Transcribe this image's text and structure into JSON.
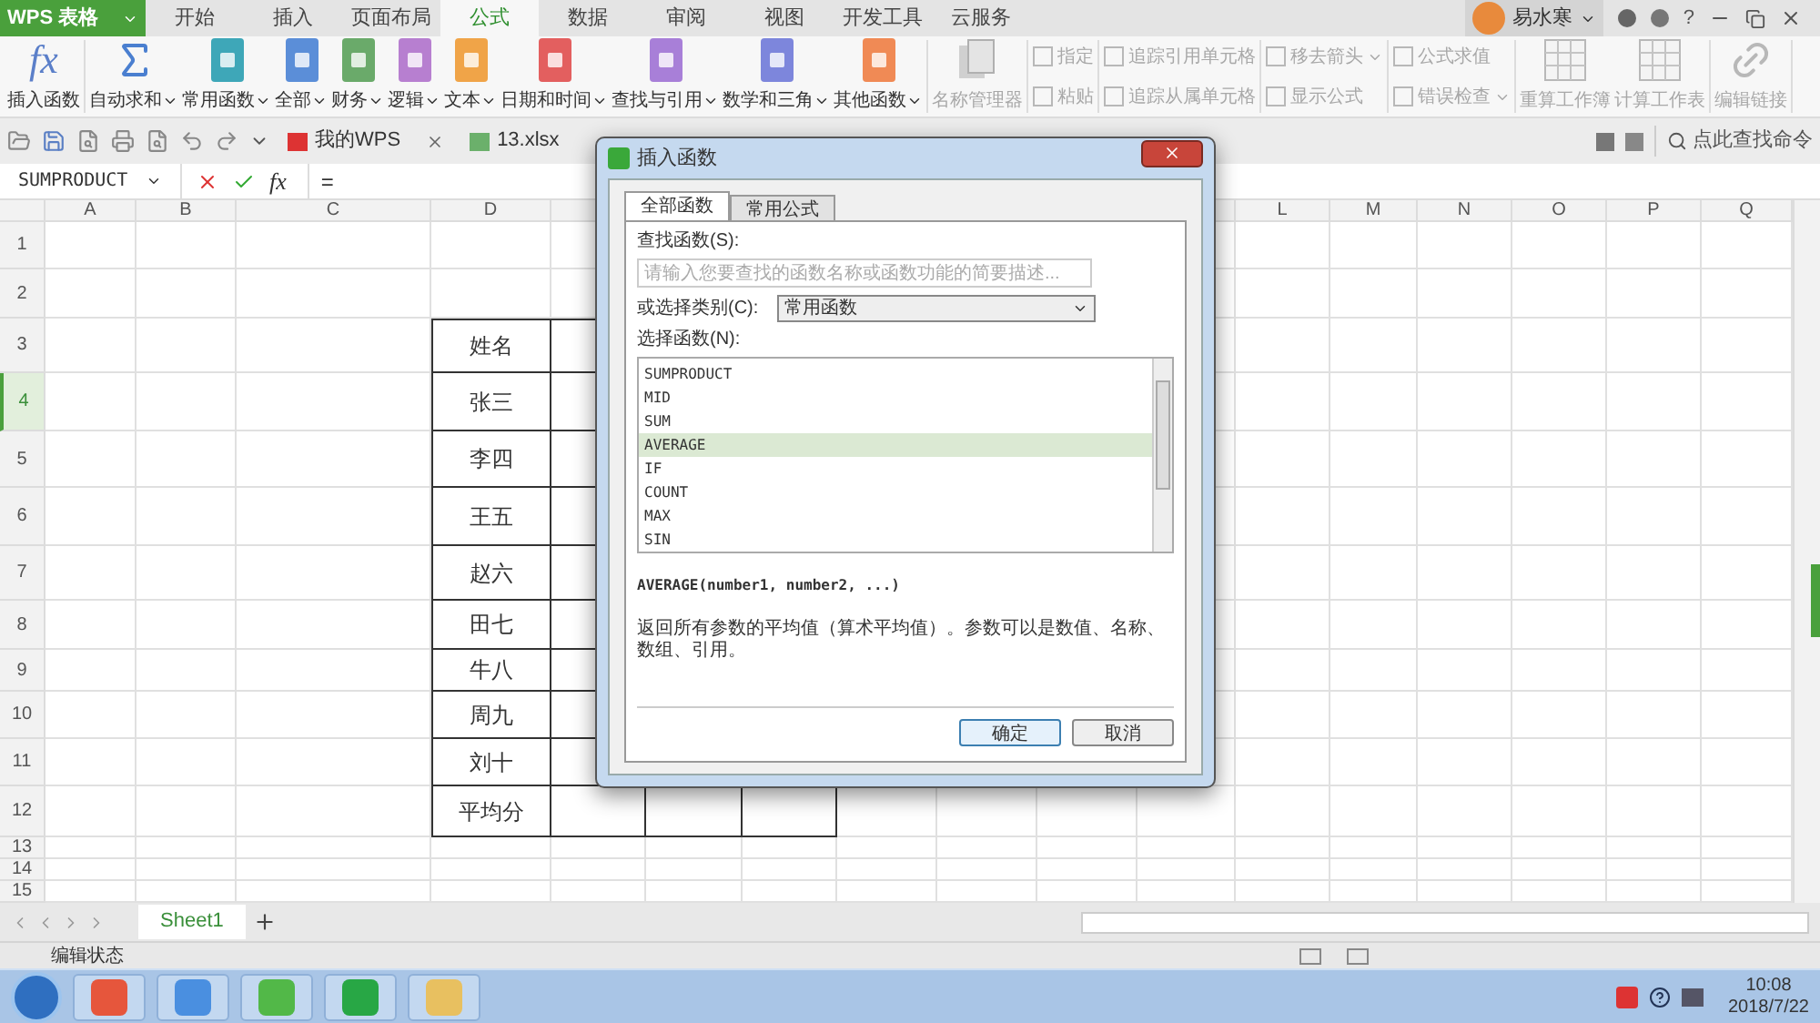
{
  "app": {
    "title": "WPS 表格"
  },
  "menu_tabs": [
    {
      "label": "开始",
      "selected": false
    },
    {
      "label": "插入",
      "selected": false
    },
    {
      "label": "页面布局",
      "selected": false
    },
    {
      "label": "公式",
      "selected": true
    },
    {
      "label": "数据",
      "selected": false
    },
    {
      "label": "审阅",
      "selected": false
    },
    {
      "label": "视图",
      "selected": false
    },
    {
      "label": "开发工具",
      "selected": false
    },
    {
      "label": "云服务",
      "selected": false
    }
  ],
  "user": {
    "name": "易水寒",
    "help": "?"
  },
  "ribbon": {
    "sections": [
      {
        "kind": "large",
        "items": [
          {
            "kind": "fx",
            "glyph": "fx",
            "label": "插入函数",
            "dropdown": false,
            "disabled": false
          }
        ]
      },
      {
        "kind": "large",
        "items": [
          {
            "kind": "sum",
            "label": "自动求和",
            "dropdown": true,
            "disabled": false
          },
          {
            "kind": "book",
            "label": "常用函数",
            "dropdown": true,
            "disabled": false,
            "color": "#3ea7b8"
          },
          {
            "kind": "book",
            "label": "全部",
            "dropdown": true,
            "disabled": false,
            "color": "#5b8ed8"
          },
          {
            "kind": "book",
            "label": "财务",
            "dropdown": true,
            "disabled": false,
            "color": "#6aaa6a"
          },
          {
            "kind": "book",
            "label": "逻辑",
            "dropdown": true,
            "disabled": false,
            "color": "#b77fd0"
          },
          {
            "kind": "book",
            "label": "文本",
            "dropdown": true,
            "disabled": false,
            "color": "#f0a448"
          },
          {
            "kind": "book",
            "label": "日期和时间",
            "dropdown": true,
            "disabled": false,
            "color": "#e35f5f"
          },
          {
            "kind": "book",
            "label": "查找与引用",
            "dropdown": true,
            "disabled": false,
            "color": "#a87fd8"
          },
          {
            "kind": "book",
            "label": "数学和三角",
            "dropdown": true,
            "disabled": false,
            "color": "#7d86dc"
          },
          {
            "kind": "book",
            "label": "其他函数",
            "dropdown": true,
            "disabled": false,
            "color": "#f08a55"
          }
        ]
      },
      {
        "kind": "large",
        "items": [
          {
            "kind": "doc",
            "label": "名称管理器",
            "dropdown": false,
            "disabled": true
          }
        ]
      },
      {
        "kind": "stack",
        "items": [
          {
            "kind": "small",
            "label": "指定",
            "dropdown": false,
            "disabled": true
          },
          {
            "kind": "small",
            "label": "粘贴",
            "dropdown": false,
            "disabled": true
          }
        ]
      },
      {
        "kind": "stack",
        "items": [
          {
            "kind": "small",
            "label": "追踪引用单元格",
            "dropdown": false,
            "disabled": true
          },
          {
            "kind": "small",
            "label": "追踪从属单元格",
            "dropdown": false,
            "disabled": true
          }
        ]
      },
      {
        "kind": "stack",
        "items": [
          {
            "kind": "small",
            "label": "移去箭头",
            "dropdown": true,
            "disabled": true
          },
          {
            "kind": "small",
            "label": "显示公式",
            "dropdown": false,
            "disabled": true
          }
        ]
      },
      {
        "kind": "stack",
        "items": [
          {
            "kind": "small",
            "label": "公式求值",
            "dropdown": false,
            "disabled": true
          },
          {
            "kind": "small",
            "label": "错误检查",
            "dropdown": true,
            "disabled": true
          }
        ]
      },
      {
        "kind": "large",
        "items": [
          {
            "kind": "table",
            "label": "重算工作簿",
            "dropdown": false,
            "disabled": true
          },
          {
            "kind": "table",
            "label": "计算工作表",
            "dropdown": false,
            "disabled": true
          }
        ]
      },
      {
        "kind": "large",
        "items": [
          {
            "kind": "link",
            "label": "编辑链接",
            "dropdown": false,
            "disabled": true
          }
        ]
      }
    ]
  },
  "doc_tabs": [
    {
      "label": "我的WPS",
      "closable": true
    },
    {
      "label": "13.xlsx",
      "closable": false
    }
  ],
  "command_search": {
    "placeholder": "点此查找命令"
  },
  "formula_bar": {
    "name_box": "SUMPRODUCT",
    "fx": "fx",
    "value": "="
  },
  "sheet": {
    "columns_left": [
      "A",
      "B",
      "C",
      "D"
    ],
    "columns_right": [
      "L",
      "M",
      "N",
      "O",
      "P",
      "Q"
    ],
    "rows": [
      {
        "number": "1",
        "selected": false
      },
      {
        "number": "2",
        "selected": false
      },
      {
        "number": "3",
        "selected": false,
        "column_D": "姓名"
      },
      {
        "number": "4",
        "selected": true,
        "column_D": "张三"
      },
      {
        "number": "5",
        "selected": false,
        "column_D": "李四"
      },
      {
        "number": "6",
        "selected": false,
        "column_D": "王五"
      },
      {
        "number": "7",
        "selected": false,
        "column_D": "赵六"
      },
      {
        "number": "8",
        "selected": false,
        "column_D": "田七"
      },
      {
        "number": "9",
        "selected": false,
        "column_D": "牛八"
      },
      {
        "number": "10",
        "selected": false,
        "column_D": "周九"
      },
      {
        "number": "11",
        "selected": false,
        "column_D": "刘十"
      },
      {
        "number": "12",
        "selected": false,
        "column_D": "平均分"
      },
      {
        "number": "13",
        "selected": false
      },
      {
        "number": "14",
        "selected": false
      },
      {
        "number": "15",
        "selected": false
      }
    ]
  },
  "sheet_tabs": [
    {
      "label": "Sheet1",
      "selected": true
    }
  ],
  "status_bar": {
    "text": "编辑状态"
  },
  "dialog": {
    "title": "插入函数",
    "tabs": [
      {
        "label": "全部函数",
        "selected": true
      },
      {
        "label": "常用公式",
        "selected": false
      }
    ],
    "search_label": "查找函数(S):",
    "search_placeholder": "请输入您要查找的函数名称或函数功能的简要描述...",
    "category_label": "或选择类别(C):",
    "category_value": "常用函数",
    "list_label": "选择函数(N):",
    "functions": [
      {
        "name": "SUMPRODUCT",
        "selected": false
      },
      {
        "name": "MID",
        "selected": false
      },
      {
        "name": "SUM",
        "selected": false
      },
      {
        "name": "AVERAGE",
        "selected": true
      },
      {
        "name": "IF",
        "selected": false
      },
      {
        "name": "COUNT",
        "selected": false
      },
      {
        "name": "MAX",
        "selected": false
      },
      {
        "name": "SIN",
        "selected": false
      }
    ],
    "signature": "AVERAGE(number1, number2, ...)",
    "description": "返回所有参数的平均值（算术平均值）。参数可以是数值、名称、数组、引用。",
    "buttons": [
      "确定",
      "取消"
    ]
  },
  "taskbar": {
    "time": "10:08",
    "date": "2018/7/22"
  }
}
